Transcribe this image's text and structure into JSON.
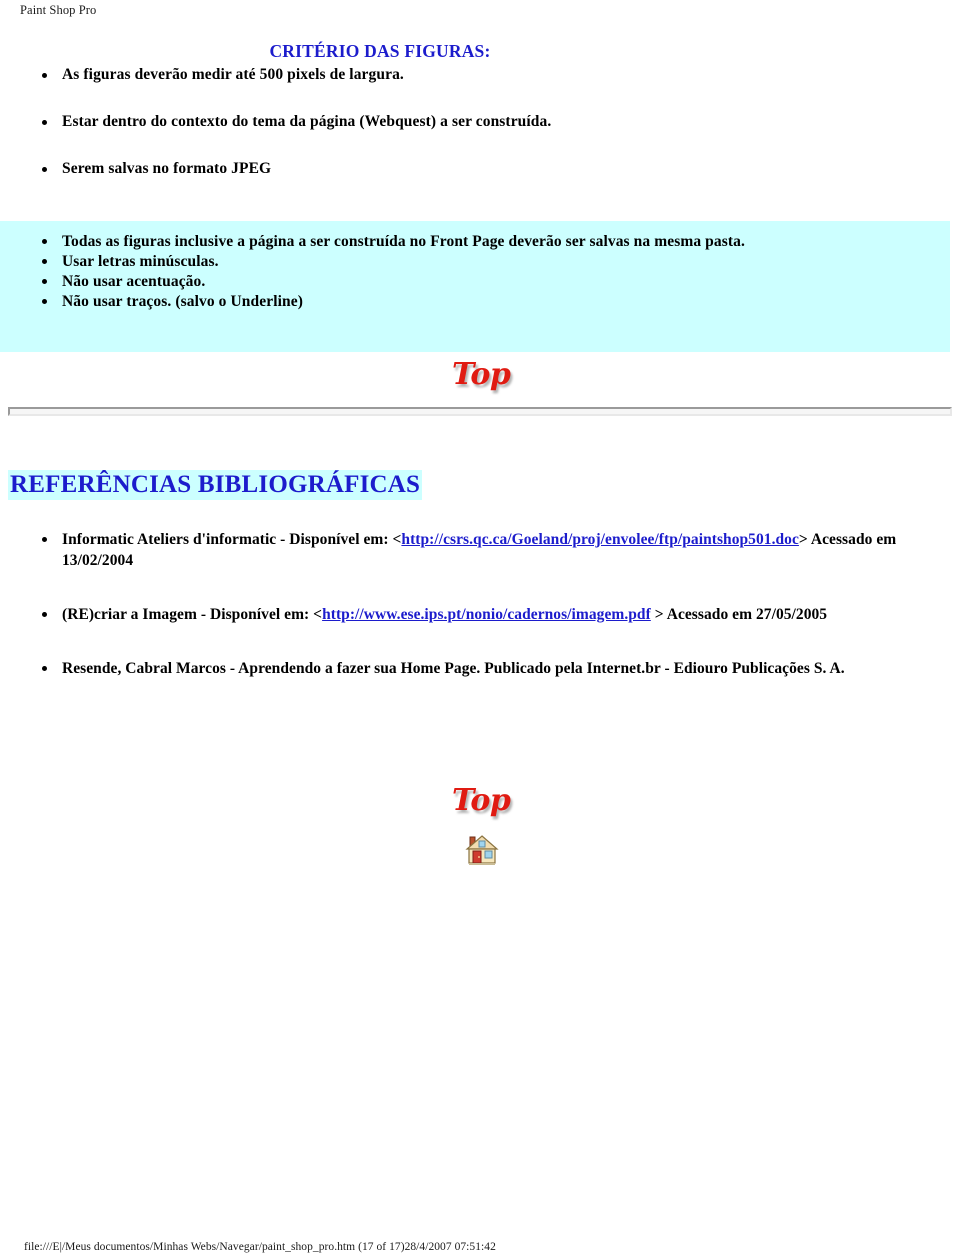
{
  "header": {
    "running_title": "Paint Shop Pro"
  },
  "criteria": {
    "title": "CRITÉRIO DAS FIGURAS:",
    "items_white": [
      "As figuras deverão medir até 500 pixels de largura.",
      "Estar dentro do contexto do tema da página (Webquest) a ser construída.",
      "Serem salvas no formato JPEG"
    ],
    "items_highlighted": [
      "Todas as figuras inclusive a página a ser construída no Front Page deverão ser salvas na mesma pasta.",
      "Usar letras minúsculas.",
      "Não usar acentuação.",
      "Não usar traços. (salvo o Underline)"
    ]
  },
  "graphics": {
    "top_label": "Top",
    "top_color": "#e01b12",
    "home_icon_name": "home-icon"
  },
  "references": {
    "heading": "REFERÊNCIAS BIBLIOGRÁFICAS",
    "heading_color": "#1c1ccc",
    "highlight_color": "#ccffff",
    "items": [
      {
        "prefix": "Informatic Ateliers d'informatic - Disponível em: <",
        "link": "http://csrs.qc.ca/Goeland/proj/envolee/ftp/paintshop501.doc",
        "suffix": "> Acessado em 13/02/2004"
      },
      {
        "prefix": "(RE)criar a Imagem - Disponível em: <",
        "link": "http://www.ese.ips.pt/nonio/cadernos/imagem.pdf",
        "suffix": " > Acessado em 27/05/2005"
      },
      {
        "prefix": "Resende, Cabral Marcos - Aprendendo a fazer sua Home Page. Publicado pela Internet.br - Ediouro Publicações S. A.",
        "link": "",
        "suffix": ""
      }
    ]
  },
  "footer": {
    "path_text": "file:///E|/Meus documentos/Minhas Webs/Navegar/paint_shop_pro.htm (17 of 17)28/4/2007 07:51:42"
  }
}
